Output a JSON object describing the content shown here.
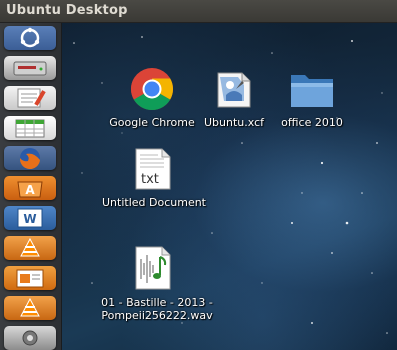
{
  "topbar": {
    "title": "Ubuntu Desktop"
  },
  "launcher": {
    "items": [
      {
        "icon": "dash-home-icon"
      },
      {
        "icon": "disk-drive-icon"
      },
      {
        "icon": "text-editor-icon"
      },
      {
        "icon": "spreadsheet-icon"
      },
      {
        "icon": "firefox-icon"
      },
      {
        "icon": "software-center-icon"
      },
      {
        "icon": "writer-icon"
      },
      {
        "icon": "vlc-icon"
      },
      {
        "icon": "impress-icon"
      },
      {
        "icon": "vlc-icon"
      },
      {
        "icon": "settings-icon"
      }
    ]
  },
  "desktop": {
    "icons": [
      {
        "label": "Google Chrome",
        "icon": "chrome-icon"
      },
      {
        "label": "Ubuntu.xcf",
        "icon": "xcf-image-file-icon"
      },
      {
        "label": "office 2010",
        "icon": "folder-icon"
      },
      {
        "label": "Untitled Document",
        "icon": "text-file-icon",
        "badge": "txt"
      },
      {
        "label_line1": "01 - Bastille - 2013 -",
        "label_line2": "Pompeii256222.wav",
        "icon": "audio-file-icon"
      }
    ]
  }
}
